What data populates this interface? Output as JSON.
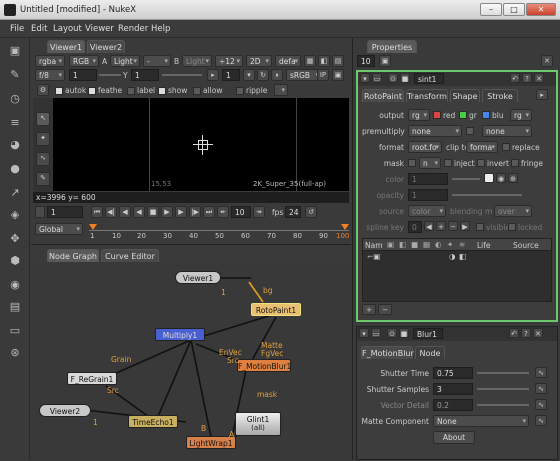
{
  "window": {
    "title": "Untitled [modified] - NukeX",
    "min": "–",
    "max": "□",
    "close": "✕"
  },
  "menu": [
    "File",
    "Edit",
    "Layout",
    "Viewer",
    "Render",
    "Help"
  ],
  "viewer": {
    "tabs": [
      "Viewer1",
      "Viewer2"
    ],
    "channels": "rgba",
    "channels2": "RGB",
    "a_label": "A",
    "a_input": "Light",
    "dash": "-",
    "b_label": "B",
    "b_input": "Light",
    "proxy": "÷12",
    "mode": "2D",
    "lut": "defa",
    "fstop": "f/8",
    "gain": "1",
    "y_label": "Y",
    "gamma": "1",
    "zero": "1",
    "colorspace": "sRGB",
    "opt_autokey": "autok",
    "opt_feather": "feathe",
    "opt_label": "label",
    "opt_show": "show",
    "opt_allow": "allow",
    "opt_ripple": "ripple",
    "coords_left": "15,53",
    "format_text": "2K_Super_35(full-ap)",
    "cursor_info": "x=3996 y= 600",
    "frame": "1",
    "step": "10",
    "fps_label": "fps",
    "fps": "24",
    "range_mode": "Global",
    "timeline_ticks": [
      "1",
      "10",
      "20",
      "30",
      "40",
      "50",
      "60",
      "70",
      "80",
      "90",
      "100"
    ]
  },
  "graph": {
    "tabs": [
      "Node Graph",
      "Curve Editor"
    ],
    "nodes": {
      "viewer1": "Viewer1",
      "rotopaint": "RotoPaint1",
      "merge": "Multiply1",
      "motionblur": "F_MotionBlur1",
      "regrain": "F_ReGrain1",
      "viewer2": "Viewer2",
      "timeecho": "TimeEcho1",
      "glint": "Glint1",
      "glint_sub": "(all)",
      "lightwrap": "LightWrap1"
    },
    "labels": {
      "bg": "bg",
      "one_a": "1",
      "one_b": "1",
      "grain": "Grain",
      "src": "Src",
      "envec": "EnVec",
      "src2": "Src",
      "matte": "Matte",
      "fgvec": "FgVec",
      "mask": "mask",
      "b": "B",
      "a": "A"
    }
  },
  "props": {
    "panel_title": "Properties",
    "count": "10",
    "node1": {
      "name": "sint1",
      "tabs": [
        "RotoPaint",
        "Transform",
        "Shape",
        "Stroke"
      ],
      "output_label": "output",
      "output_val": "rg",
      "ch_r": "red",
      "ch_g": "gr",
      "ch_b": "blu",
      "ch_a": "rg",
      "premult_label": "premultiply",
      "premult_val": "none",
      "premult_val2": "none",
      "format_label": "format",
      "format_val": "root.fo",
      "clipto_label": "clip to",
      "clipto_val": "forma",
      "replace": "replace",
      "mask_label": "mask",
      "mask_val": "n",
      "inject": "inject",
      "invert": "invert",
      "fringe": "fringe",
      "color_label": "color",
      "color_val": "1",
      "opacity_label": "opacity",
      "opacity_val": "1",
      "source_label": "source",
      "source_val": "color",
      "blending_label": "blending m",
      "blending_val": "over",
      "spline_label": "spline key",
      "spline_val": "0",
      "visible": "visible",
      "locked": "locked",
      "list_cols": [
        "Nam",
        "Life",
        "Source"
      ],
      "plus": "+",
      "minus": "−"
    },
    "node2": {
      "name": "Blur1",
      "tabs": [
        "F_MotionBlur",
        "Node"
      ],
      "shutter_time_label": "Shutter Time",
      "shutter_time_val": "0.75",
      "shutter_samples_label": "Shutter Samples",
      "shutter_samples_val": "3",
      "vector_detail_label": "Vector Detail",
      "vector_detail_val": "0.2",
      "matte_label": "Matte Component",
      "matte_val": "None",
      "about": "About"
    }
  },
  "colors": {
    "node_border_active": "#6cc86c",
    "roto": "#e8c070",
    "merge": "#4a5fd0",
    "mblur": "#e08040",
    "regrain": "#d8d8d8",
    "viewer": "#c8c8c8",
    "timeecho": "#c8b060",
    "lightwrap": "#d8804a"
  }
}
